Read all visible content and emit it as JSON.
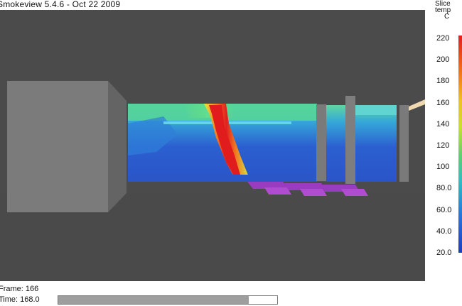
{
  "window": {
    "title": "Smokeview 5.4.6  -  Oct 22 2009"
  },
  "status": {
    "frame_text": "Frame: 166",
    "time_text": "Time: 168.0",
    "progress_fraction": 0.87
  },
  "legend": {
    "title_lines": [
      "Slice",
      "temp",
      "C"
    ],
    "ticks": [
      "220",
      "200",
      "180",
      "160",
      "140",
      "120",
      "100",
      "80.0",
      "60.0",
      "40.0",
      "20.0"
    ],
    "colors": {
      "hot": "#e0201e",
      "warm": "#f0c020",
      "mild": "#40c8a0",
      "cool": "#2b6fd8",
      "cold": "#1a3ec0"
    }
  },
  "scene": {
    "background": "#4b4b4b",
    "obstacle_color": "#7a7a7a",
    "vent_color": "#9a3cc0"
  }
}
